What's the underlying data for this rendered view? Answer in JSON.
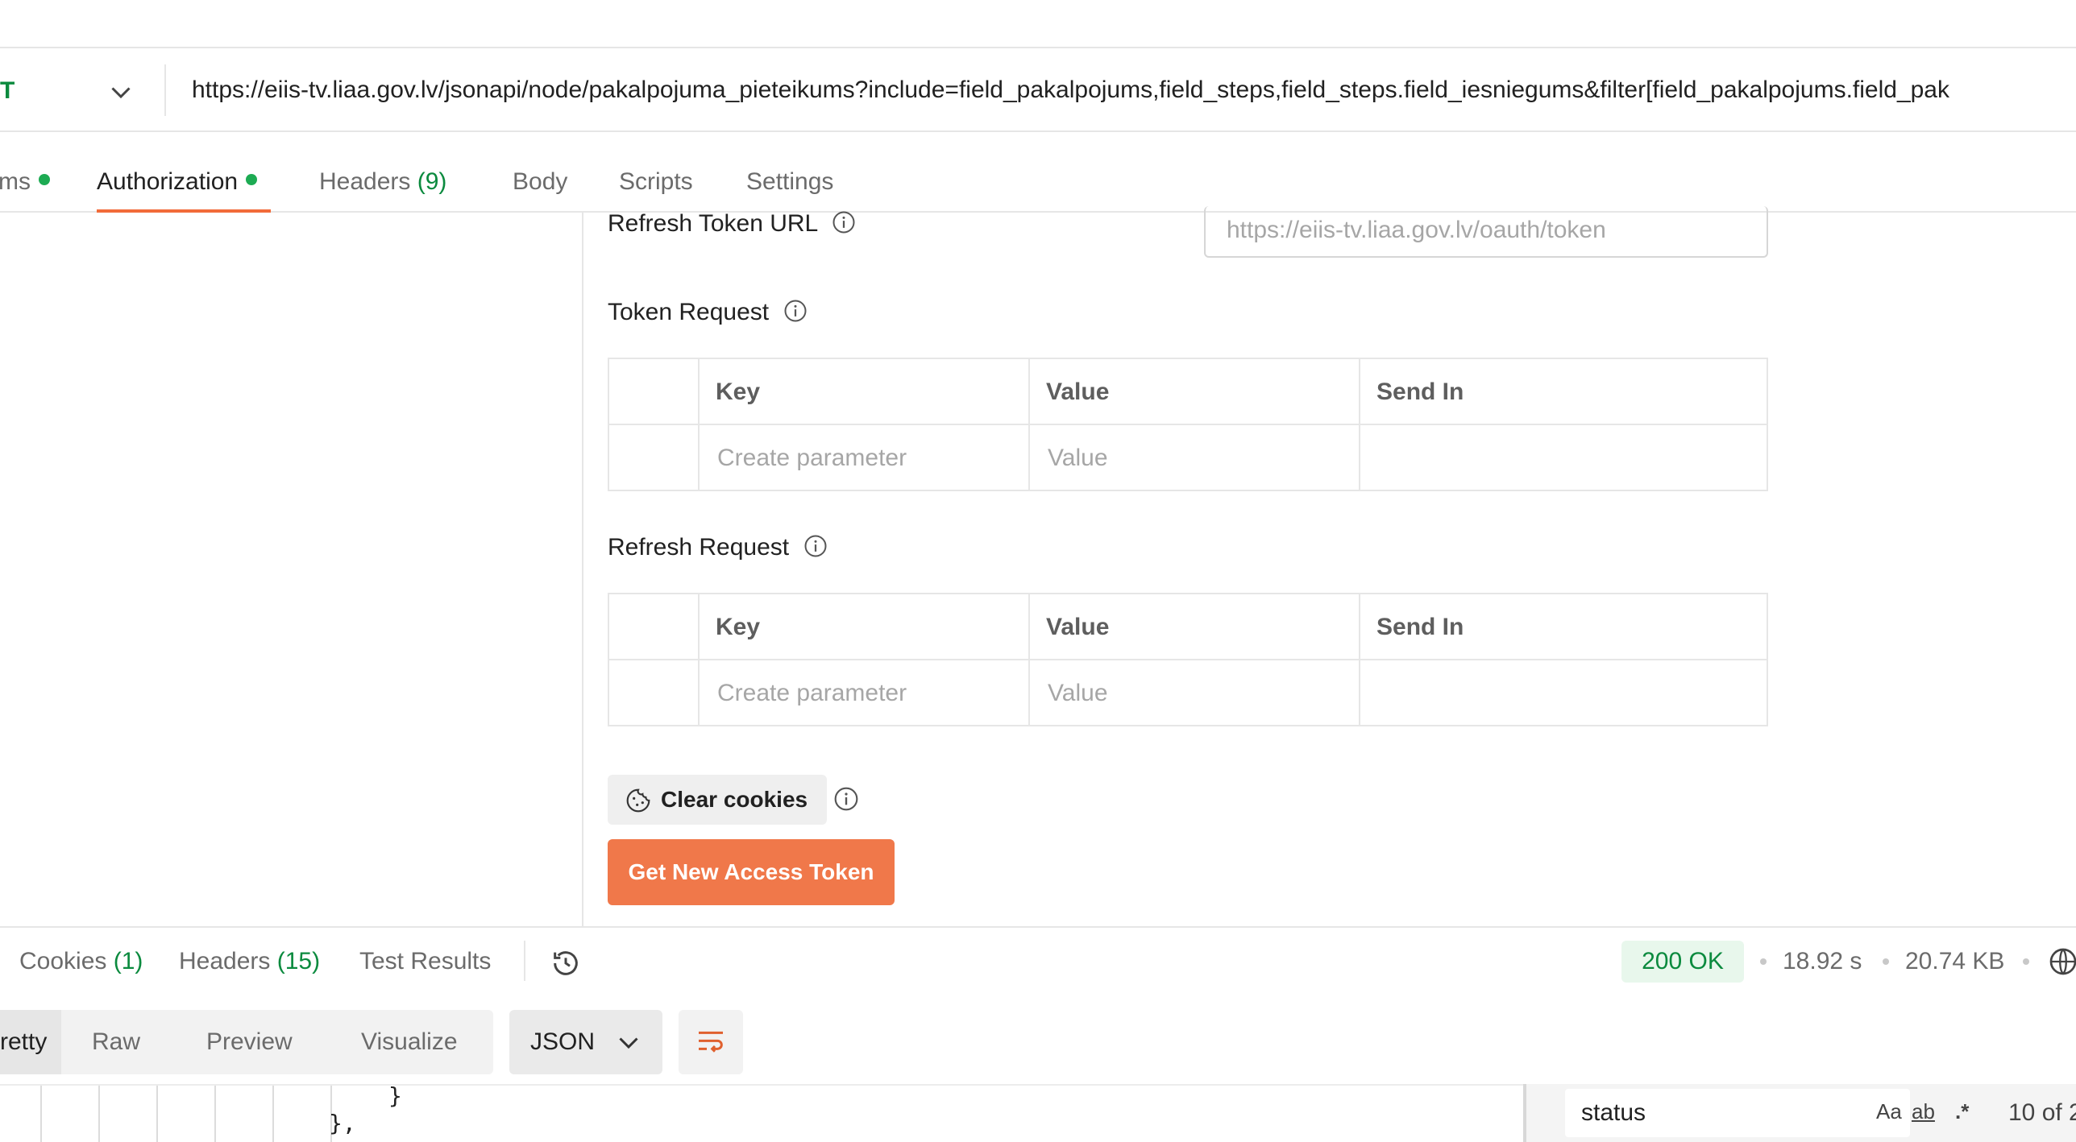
{
  "request": {
    "method": "T",
    "url": "https://eiis-tv.liaa.gov.lv/jsonapi/node/pakalpojuma_pieteikums?include=field_pakalpojums,field_steps,field_steps.field_iesniegums&filter[field_pakalpojums.field_pak"
  },
  "request_tabs": {
    "params": "ms",
    "authorization": "Authorization",
    "headers": "Headers",
    "headers_count": "(9)",
    "body": "Body",
    "scripts": "Scripts",
    "settings": "Settings"
  },
  "auth": {
    "refresh_token_url_label": "Refresh Token URL",
    "refresh_token_url_placeholder": "https://eiis-tv.liaa.gov.lv/oauth/token",
    "token_request_label": "Token Request",
    "refresh_request_label": "Refresh Request",
    "table_headers": {
      "key": "Key",
      "value": "Value",
      "send_in": "Send In"
    },
    "row_placeholders": {
      "key": "Create parameter",
      "value": "Value"
    },
    "clear_cookies_label": "Clear cookies",
    "get_new_token_label": "Get New Access Token"
  },
  "response": {
    "cookies": "Cookies",
    "cookies_count": "(1)",
    "headers": "Headers",
    "headers_count": "(15)",
    "test_results": "Test Results",
    "status": "200 OK",
    "time": "18.92 s",
    "size": "20.74 KB"
  },
  "format_bar": {
    "pretty": "Pretty",
    "raw": "Raw",
    "preview": "Preview",
    "visualize": "Visualize",
    "format": "JSON"
  },
  "code": {
    "line1": "}",
    "line2": "},"
  },
  "find": {
    "query": "status",
    "match_case": "Aa",
    "whole_word": "ab",
    "regex": ".*",
    "count": "10 of 2"
  },
  "colors": {
    "accent": "#f26b3a",
    "button_primary": "#f0784a",
    "success": "#0b8a3e",
    "status_dot": "#1dab53"
  },
  "icons": [
    "chevron-down-icon",
    "info-icon",
    "cookie-icon",
    "history-icon",
    "globe-icon",
    "wrap-lines-icon"
  ]
}
